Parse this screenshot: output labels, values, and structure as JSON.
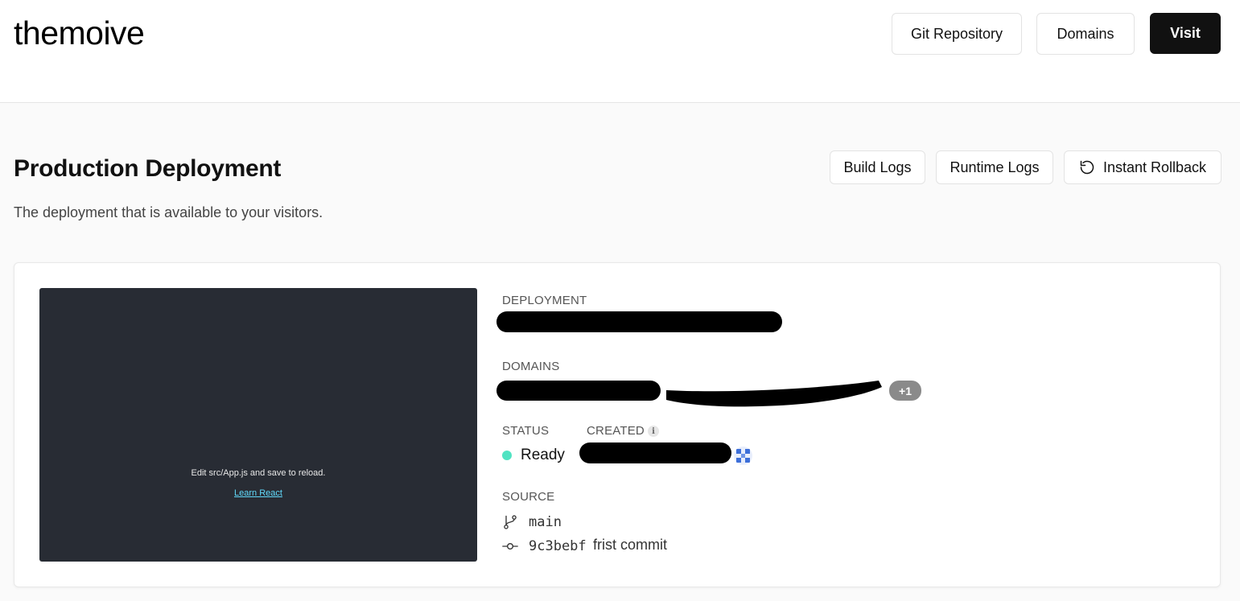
{
  "header": {
    "project_name": "themoive",
    "git_repository_label": "Git Repository",
    "domains_label": "Domains",
    "visit_label": "Visit"
  },
  "section": {
    "title": "Production Deployment",
    "subtitle": "The deployment that is available to your visitors.",
    "build_logs_label": "Build Logs",
    "runtime_logs_label": "Runtime Logs",
    "instant_rollback_label": "Instant Rollback"
  },
  "preview": {
    "edit_text": "Edit src/App.js and save to reload.",
    "learn_link": "Learn React"
  },
  "details": {
    "deployment_label": "DEPLOYMENT",
    "domains_label": "DOMAINS",
    "domains_more_badge": "+1",
    "status_label": "STATUS",
    "status_value": "Ready",
    "created_label": "CREATED",
    "source_label": "SOURCE",
    "branch": "main",
    "commit_hash": "9c3bebf",
    "commit_message": "frist commit"
  },
  "colors": {
    "status_ready": "#50e3c2",
    "preview_bg": "#282c34",
    "link": "#61dafb",
    "primary_button": "#111111"
  },
  "icons": {
    "rollback": "rotate-ccw-icon",
    "info": "info-icon",
    "branch": "git-branch-icon",
    "commit": "git-commit-icon"
  }
}
